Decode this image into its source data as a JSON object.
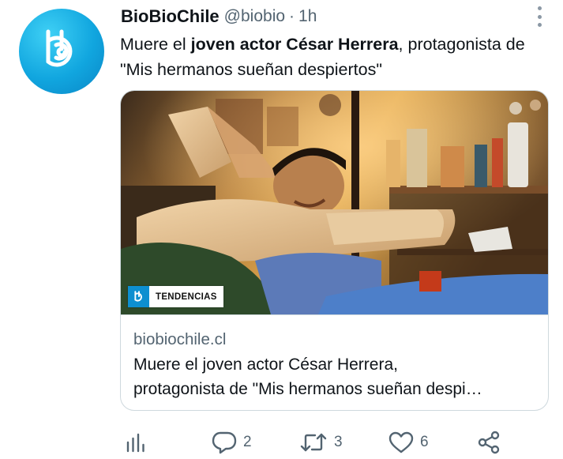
{
  "author": {
    "name": "BioBioChile",
    "handle": "@biobio",
    "separator": "·",
    "time": "1h"
  },
  "tweet": {
    "text_prefix": "Muere el ",
    "text_bold": "joven actor César Herrera",
    "text_suffix": ", protagonista de \"Mis hermanos sueñan despiertos\""
  },
  "card": {
    "badge_text": "TENDENCIAS",
    "domain": "biobiochile.cl",
    "title_line1": "Muere el joven actor César Herrera,",
    "title_line2": "protagonista de \"Mis hermanos sueñan despi…"
  },
  "actions": {
    "replies": "2",
    "retweets": "3",
    "likes": "6"
  },
  "colors": {
    "brand": "#11a6df",
    "text": "#0f1419",
    "secondary": "#536471",
    "border": "#cfd9de"
  },
  "icons": [
    "biobio-logo-icon",
    "more-icon",
    "analytics-icon",
    "reply-icon",
    "retweet-icon",
    "like-icon",
    "share-icon"
  ]
}
